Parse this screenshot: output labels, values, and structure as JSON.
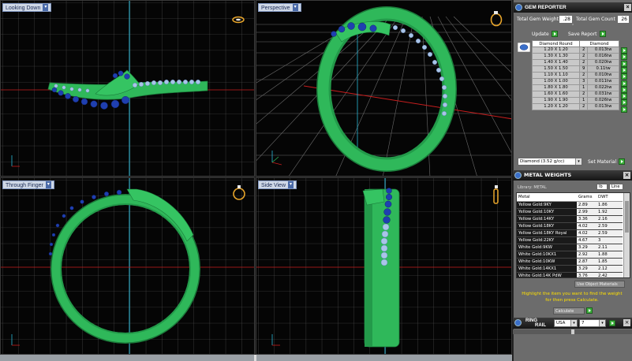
{
  "viewports": {
    "top_left": "Looking Down",
    "top_right": "Perspective",
    "bottom_left": "Through Finger",
    "bottom_right": "Side View"
  },
  "gem_reporter": {
    "title": "GEM REPORTER",
    "total_weight_label": "Total Gem Weight",
    "total_weight_value": ".28",
    "total_count_label": "Total Gem Count",
    "total_count_value": "26",
    "update_label": "Update",
    "save_report_label": "Save Report",
    "col_shape": "Diamond Round",
    "col_type": "Diamond",
    "rows": [
      {
        "size": "1.20 X 1.20",
        "count": "2",
        "weight": "0.013tw"
      },
      {
        "size": "1.30 X 1.30",
        "count": "2",
        "weight": "0.016tw"
      },
      {
        "size": "1.40 X 1.40",
        "count": "2",
        "weight": "0.020tw"
      },
      {
        "size": "1.50 X 1.50",
        "count": "9",
        "weight": "0.11tw"
      },
      {
        "size": "1.10 X 1.10",
        "count": "2",
        "weight": "0.010tw"
      },
      {
        "size": "1.00 X 1.00",
        "count": "3",
        "weight": "0.011tw"
      },
      {
        "size": "1.80 X 1.80",
        "count": "1",
        "weight": "0.022tw"
      },
      {
        "size": "1.60 X 1.60",
        "count": "2",
        "weight": "0.031tw"
      },
      {
        "size": "1.90 X 1.90",
        "count": "1",
        "weight": "0.026tw"
      },
      {
        "size": "1.20 X 1.20",
        "count": "2",
        "weight": "0.013tw"
      }
    ],
    "material_select": "Diamond   (3.52 g/cc)",
    "set_material_label": "Set Material"
  },
  "metal_weights": {
    "title": "METAL WEIGHTS",
    "library_label": "Library: METAL",
    "units": [
      "Ib",
      "Line"
    ],
    "col_metal": "Metal",
    "col_grams": "Grams",
    "col_dwt": "DWT",
    "rows": [
      {
        "metal": "Yellow Gold:9KY",
        "grams": "2.89",
        "dwt": "1.86"
      },
      {
        "metal": "Yellow Gold:10KY",
        "grams": "2.99",
        "dwt": "1.92"
      },
      {
        "metal": "Yellow Gold:14KY",
        "grams": "3.36",
        "dwt": "2.16"
      },
      {
        "metal": "Yellow Gold:18KY",
        "grams": "4.02",
        "dwt": "2.59"
      },
      {
        "metal": "Yellow Gold:18KY Royal",
        "grams": "4.02",
        "dwt": "2.59"
      },
      {
        "metal": "Yellow Gold:22KY",
        "grams": "4.67",
        "dwt": "3"
      },
      {
        "metal": "White Gold:9KW",
        "grams": "3.29",
        "dwt": "2.11"
      },
      {
        "metal": "White Gold:10KX1",
        "grams": "2.92",
        "dwt": "1.88"
      },
      {
        "metal": "White Gold:10KW",
        "grams": "2.87",
        "dwt": "1.85"
      },
      {
        "metal": "White Gold:14KX1",
        "grams": "3.29",
        "dwt": "2.12"
      },
      {
        "metal": "White Gold:14K PdW",
        "grams": "3.76",
        "dwt": "2.42"
      }
    ],
    "use_object_materials": "Use Object Materials",
    "hint_line1": "Highlight the item you want to find the weight",
    "hint_line2": "for then press Calculate.",
    "calculate_label": "Calculate"
  },
  "ring_rail": {
    "title_line1": "RING",
    "title_line2": "RAIL",
    "region": "USA",
    "size": "7"
  },
  "colors": {
    "ring_green": "#2fb85a",
    "gem_blue": "#1f3fb0",
    "stone_light": "#a9c4e8",
    "grid": "#6b6b6b",
    "axis_red": "#c81e1e",
    "axis_cyan": "#29b6d6"
  }
}
